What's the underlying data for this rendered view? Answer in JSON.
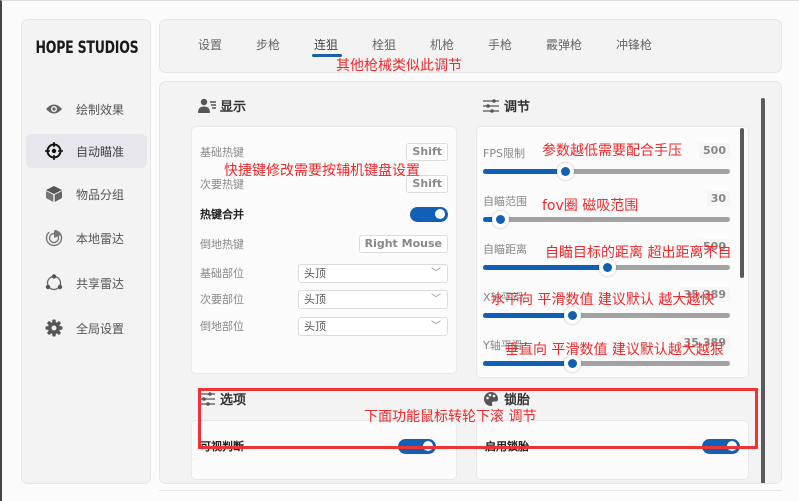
{
  "brand": {
    "logo": "HOPE STUDIOS"
  },
  "sidebar": {
    "items": [
      {
        "label": "绘制效果",
        "icon": "eye-icon",
        "active": false
      },
      {
        "label": "自动瞄准",
        "icon": "crosshair-icon",
        "active": true
      },
      {
        "label": "物品分组",
        "icon": "box-icon",
        "active": false
      },
      {
        "label": "本地雷达",
        "icon": "radar-icon",
        "active": false
      },
      {
        "label": "共享雷达",
        "icon": "share-icon",
        "active": false
      },
      {
        "label": "全局设置",
        "icon": "gear-icon",
        "active": false
      }
    ]
  },
  "tabs": [
    {
      "label": "设置",
      "active": false
    },
    {
      "label": "步枪",
      "active": false
    },
    {
      "label": "连狙",
      "active": true
    },
    {
      "label": "栓狙",
      "active": false
    },
    {
      "label": "机枪",
      "active": false
    },
    {
      "label": "手枪",
      "active": false
    },
    {
      "label": "霰弹枪",
      "active": false
    },
    {
      "label": "冲锋枪",
      "active": false
    }
  ],
  "display": {
    "title": "显示",
    "rows": {
      "base_hotkey": {
        "label": "基础热键",
        "value": "Shift"
      },
      "secondary_hotkey": {
        "label": "次要热键",
        "value": "Shift"
      },
      "hotkey_merge": {
        "label": "热键合并",
        "enabled": true
      },
      "downed_hotkey": {
        "label": "倒地热键",
        "value": "Right Mouse"
      },
      "base_part": {
        "label": "基础部位",
        "value": "头顶"
      },
      "secondary_part": {
        "label": "次要部位",
        "value": "头顶"
      },
      "downed_part": {
        "label": "倒地部位",
        "value": "头顶"
      }
    }
  },
  "adjust": {
    "title": "调节",
    "sliders": [
      {
        "label": "FPS限制",
        "value": "500",
        "fraction": 0.33
      },
      {
        "label": "自瞄范围",
        "value": "30",
        "fraction": 0.07
      },
      {
        "label": "自瞄距离",
        "value": "500",
        "fraction": 0.5
      },
      {
        "label": "X轴平滑",
        "value": "35.389",
        "fraction": 0.36
      },
      {
        "label": "Y轴平滑",
        "value": "35.389",
        "fraction": 0.36
      }
    ]
  },
  "options": {
    "title": "选项",
    "first_row": {
      "label": "可视判断",
      "enabled": true
    }
  },
  "lock_tire": {
    "title": "锁胎",
    "first_row": {
      "label": "启用锁胎",
      "enabled": true
    }
  },
  "annotations": {
    "tabs_note": "其他枪械类似此调节",
    "hotkey_note": "快捷键修改需要按辅机键盘设置",
    "fps_note": "参数越低需要配合手压",
    "fov_note": "fov圈 磁吸范围",
    "distance_note": "自瞄目标的距离 超出距离不自",
    "x_note": "水平向 平滑数值 建议默认 越大越快",
    "y_note": "垂直向 平滑数值 建议默认越大越狠",
    "scroll_note": "下面功能鼠标转轮下滚  调节"
  },
  "colors": {
    "accent": "#1160b5",
    "annotation": "#ee2a2a"
  }
}
